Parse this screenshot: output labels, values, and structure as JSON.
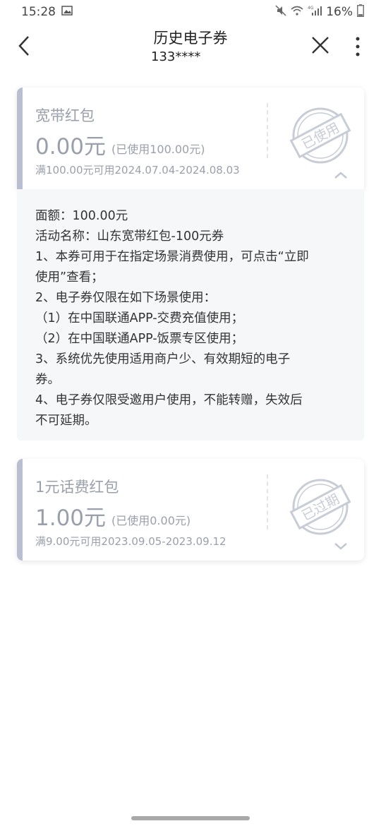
{
  "status": {
    "time": "15:28",
    "battery": "16%",
    "network": "4G"
  },
  "header": {
    "title": "历史电子券",
    "subtitle": "133****"
  },
  "coupons": [
    {
      "name": "宽带红包",
      "amount": "0.00元",
      "used": "(已使用100.00元)",
      "condition": "满100.00元可用2024.07.04-2024.08.03",
      "stamp": "已使用"
    },
    {
      "name": "1元话费红包",
      "amount": "1.00元",
      "used": "(已使用0.00元)",
      "condition": "满9.00元可用2023.09.05-2023.09.12",
      "stamp": "已过期"
    }
  ],
  "detail": {
    "lines": [
      "面额：100.00元",
      "活动名称：山东宽带红包-100元券",
      "1、本券可用于在指定场景消费使用，可点击“立即",
      "使用”查看；",
      "2、电子券仅限在如下场景使用：",
      "（1）在中国联通APP-交费充值使用；",
      "（2）在中国联通APP-饭票专区使用；",
      "3、系统优先使用适用商户少、有效期短的电子",
      "券。",
      "4、电子券仅限受邀用户使用，不能转赠，失效后",
      "不可延期。"
    ]
  },
  "colors": {
    "stamp": "#c8ccd6",
    "coupon_text": "#9aa0ab",
    "accent_bar": "#b9bfd0"
  }
}
